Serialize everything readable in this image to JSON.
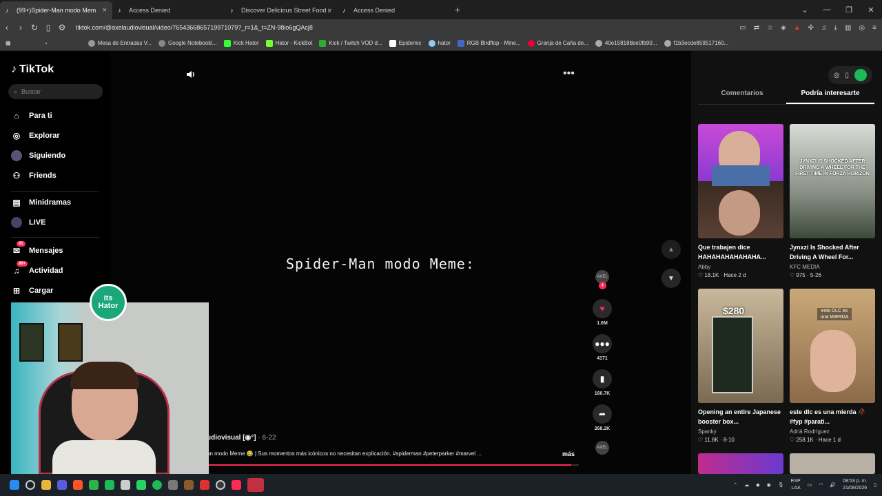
{
  "browser": {
    "tabs": [
      {
        "label": "(99+)Spider-Man modo Mem",
        "active": true
      },
      {
        "label": "Access Denied",
        "active": false
      },
      {
        "label": "Discover Delicious Street Food in Ind",
        "active": false
      },
      {
        "label": "Access Denied",
        "active": false
      }
    ],
    "new_tab": "+",
    "url": "tiktok.com/@axelaudiovisual/video/7654366865719971079?_r=1&_t=ZN-98io6gQAcj8",
    "bookmarks": [
      "Mesa de Entradas V...",
      "Google Notebookl...",
      "Kick Hator",
      "Hator - KickBot",
      "Kick / Twitch VOD d...",
      "Epidemic",
      "hator",
      "RGB Birdflop - Mine...",
      "Granja de Caña de...",
      "40e15818bbe0fb90...",
      "f1b3ecde859517160..."
    ]
  },
  "tiktok": {
    "logo": "TikTok",
    "search_placeholder": "Buscar",
    "nav": [
      {
        "label": "Para ti",
        "icon": "home-icon"
      },
      {
        "label": "Explorar",
        "icon": "compass-icon"
      },
      {
        "label": "Siguiendo",
        "icon": "following-avatar-icon"
      },
      {
        "label": "Friends",
        "icon": "friends-icon"
      },
      {
        "label": "Minidramas",
        "icon": "film-icon"
      },
      {
        "label": "LIVE",
        "icon": "live-icon"
      },
      {
        "label": "Mensajes",
        "icon": "message-icon",
        "badge": "41"
      },
      {
        "label": "Actividad",
        "icon": "bell-icon",
        "badge": "99+"
      },
      {
        "label": "Cargar",
        "icon": "upload-icon"
      }
    ],
    "video": {
      "caption": "Spider-Man modo Meme:",
      "author": "udiovisual [◉°]",
      "date": "· 6-22",
      "description": "an modo Meme 😂 | Sus momentos más icónicos no necesitan explicación. #spiderman #peterparker #marvel ...",
      "more": "más",
      "progress": 0.98,
      "likes": "1.6M",
      "comments": "4171",
      "saves": "160.7K",
      "shares": "268.2K",
      "avatar_text": "AXEL"
    },
    "side_tabs": [
      "Comentarios",
      "Podría interesarte"
    ],
    "recommended": [
      {
        "title": "Que trabajen dice HAHAHAHAHAHAHA...",
        "author": "Abby",
        "likes": "18.1K",
        "time": "Hace 2 d"
      },
      {
        "title": "Jynxzi Is Shocked After Driving A Wheel For...",
        "author": "KFC MEDIA",
        "likes": "975",
        "time": "5-26",
        "overlay": "JYNXZI IS SHOCKED AFTER DRIVING A WHEEL FOR THE FIRST TIME IN FORZA HORIZON"
      },
      {
        "title": "Opening an entire Japanese booster box...",
        "author": "Spanky",
        "likes": "11.8K",
        "time": "8-10",
        "overlay": "$280"
      },
      {
        "title": "este dlc es una mierda 🥀 #fyp #parati...",
        "author": "Adrià Rodríguez",
        "likes": "258.1K",
        "time": "Hace 1 d",
        "overlay": "este DLC es una MIERDA"
      }
    ]
  },
  "overlay_badge": {
    "line1": "its",
    "line2": "Hator"
  },
  "taskbar": {
    "lang": "ESP",
    "lang2": "LAA",
    "time": "08:53 p. m.",
    "date": "21/08/2026"
  },
  "colors": {
    "accent": "#fe2c55",
    "green": "#1db954"
  }
}
